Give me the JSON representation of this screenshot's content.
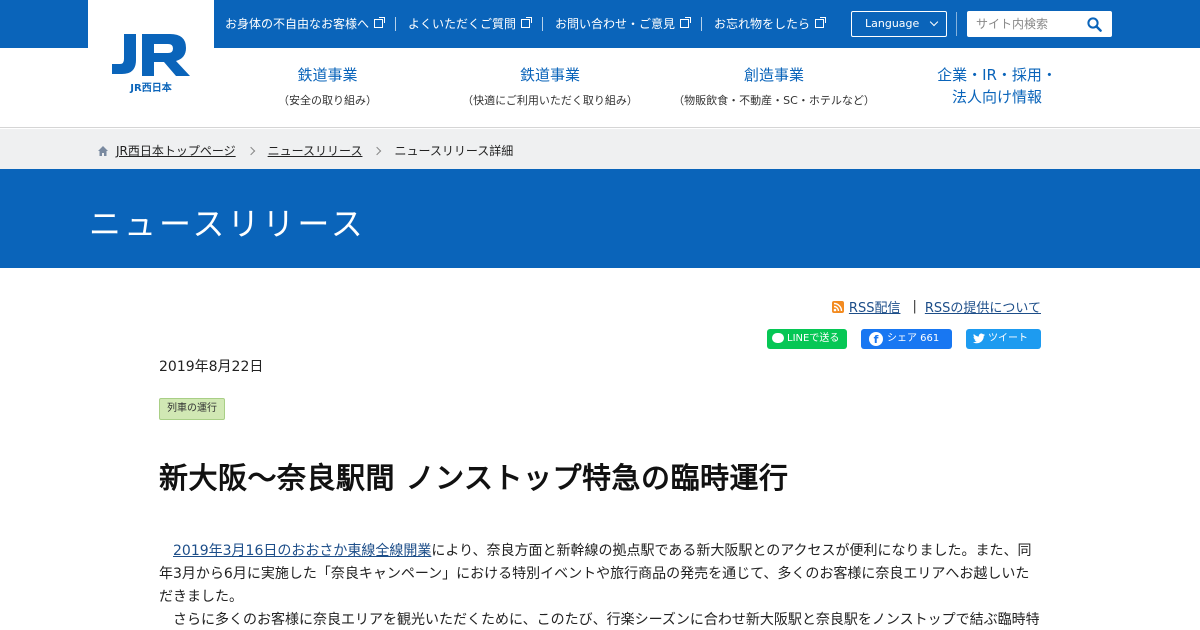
{
  "logo": {
    "wordmark": "JR西日本"
  },
  "utility_links": [
    {
      "label": "お身体の不自由なお客様へ"
    },
    {
      "label": "よくいただくご質問"
    },
    {
      "label": "お問い合わせ・ご意見"
    },
    {
      "label": "お忘れ物をしたら"
    }
  ],
  "language": {
    "label": "Language"
  },
  "search": {
    "placeholder": "サイト内検索"
  },
  "nav": [
    {
      "title": "鉄道事業",
      "sub": "（安全の取り組み）"
    },
    {
      "title": "鉄道事業",
      "sub": "（快適にご利用いただく取り組み）"
    },
    {
      "title": "創造事業",
      "sub": "（物販飲食・不動産・SC・ホテルなど）"
    },
    {
      "title_line1": "企業・IR・採用・",
      "title_line2": "法人向け情報"
    }
  ],
  "breadcrumb": {
    "home": "JR西日本トップページ",
    "section": "ニュースリリース",
    "current": "ニュースリリース詳細"
  },
  "hero": {
    "title": "ニュースリリース"
  },
  "rss": {
    "feed": "RSS配信",
    "about": "RSSの提供について"
  },
  "share": {
    "line": "LINEで送る",
    "fb": "シェア 661",
    "tweet": "ツイート"
  },
  "article": {
    "date": "2019年8月22日",
    "tag": "列車の運行",
    "title": "新大阪～奈良駅間 ノンストップ特急の臨時運行",
    "p1_link": "2019年3月16日のおおさか東線全線開業",
    "p1_text": "により、奈良方面と新幹線の拠点駅である新大阪駅とのアクセスが便利になりました。また、同年3月から6月に実施した「奈良キャンペーン」における特別イベントや旅行商品の発売を通じて、多くのお客様に奈良エリアへお越しいただきました。",
    "p2_text": "さらに多くのお客様に奈良エリアを観光いただくために、このたび、行楽シーズンに合わせ新大阪駅と奈良駅をノンストップで結ぶ臨時特"
  },
  "colors": {
    "brand_blue": "#0a64ba",
    "tag_green": "#d1e8b4",
    "line_green": "#06c755",
    "fb_blue": "#1877f2",
    "tw_blue": "#1d9bf0"
  }
}
